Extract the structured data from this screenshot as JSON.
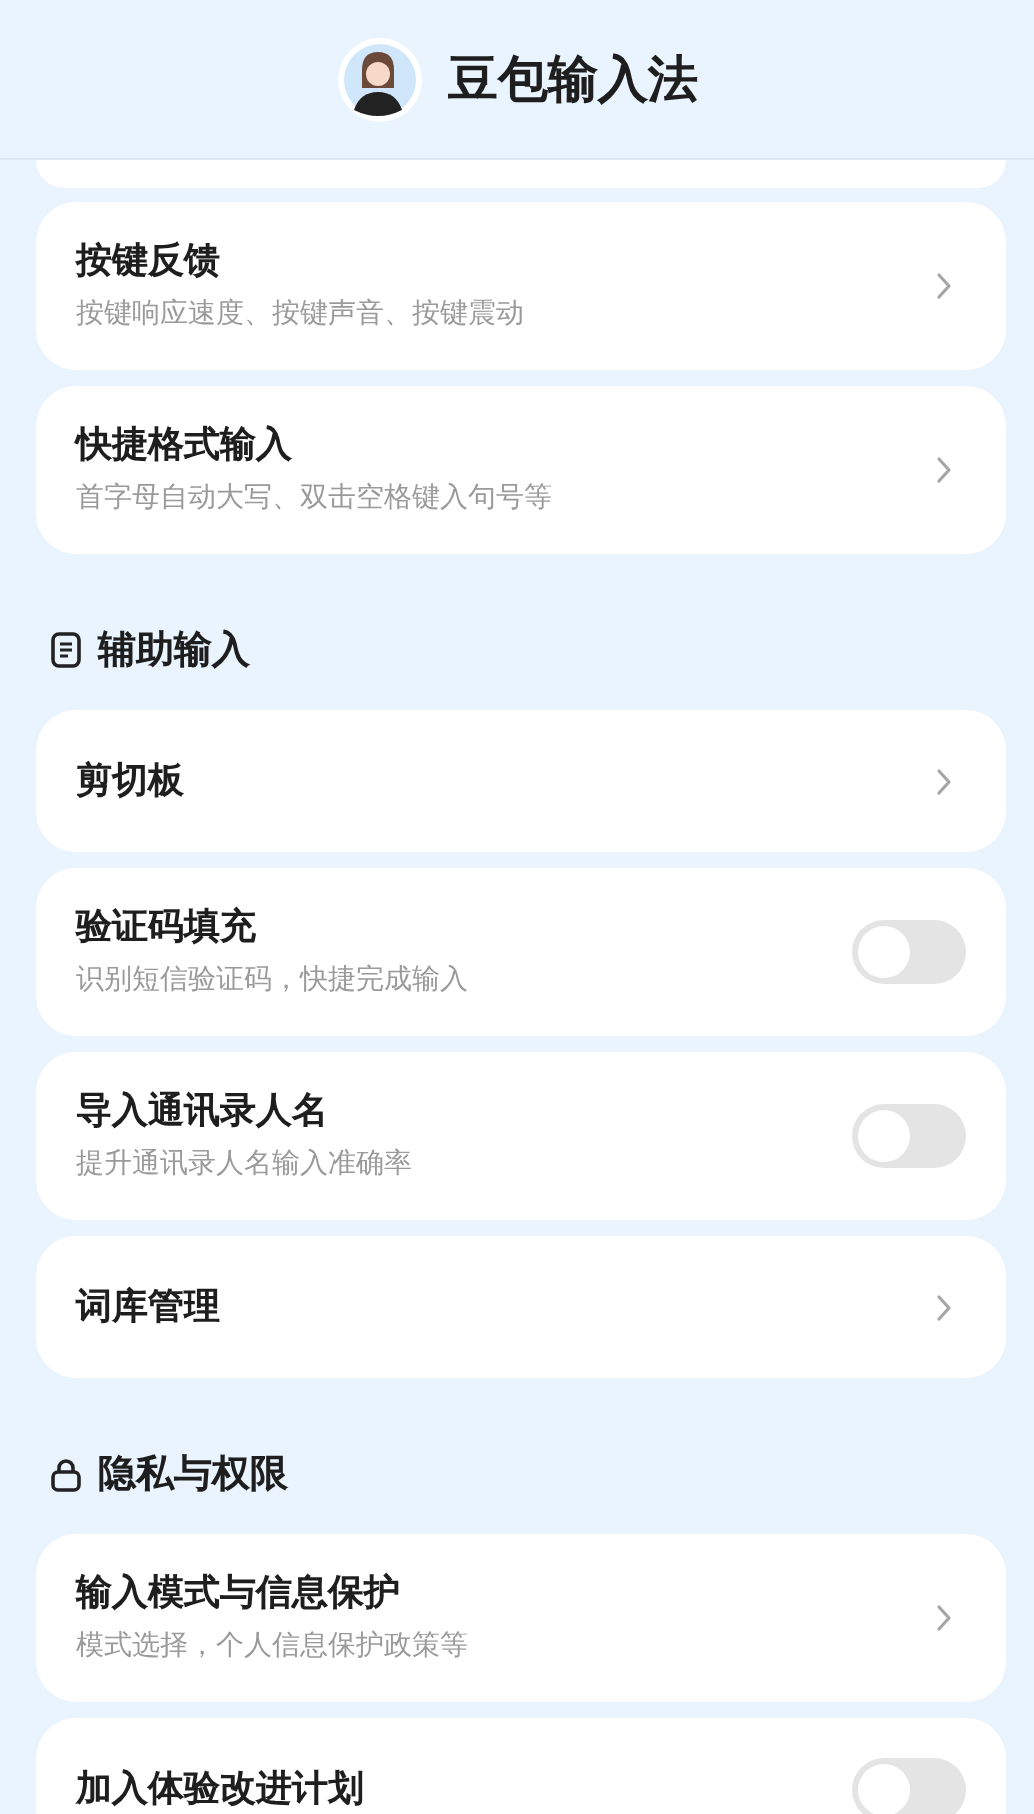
{
  "header": {
    "title": "豆包输入法"
  },
  "sections": [
    {
      "items": [
        {
          "kind": "link",
          "title": "按键反馈",
          "subtitle": "按键响应速度、按键声音、按键震动"
        },
        {
          "kind": "link",
          "title": "快捷格式输入",
          "subtitle": "首字母自动大写、双击空格键入句号等"
        }
      ]
    },
    {
      "title": "辅助输入",
      "kind": "document",
      "items": [
        {
          "kind": "link",
          "title": "剪切板"
        },
        {
          "kind": "toggle",
          "title": "验证码填充",
          "subtitle": "识别短信验证码，快捷完成输入",
          "on": false
        },
        {
          "kind": "toggle",
          "title": "导入通讯录人名",
          "subtitle": "提升通讯录人名输入准确率",
          "on": false
        },
        {
          "kind": "link",
          "title": "词库管理"
        }
      ]
    },
    {
      "title": "隐私与权限",
      "kind": "lock",
      "items": [
        {
          "kind": "link",
          "title": "输入模式与信息保护",
          "subtitle": "模式选择，个人信息保护政策等"
        },
        {
          "kind": "toggle",
          "title": "加入体验改进计划",
          "on": false
        }
      ]
    }
  ]
}
